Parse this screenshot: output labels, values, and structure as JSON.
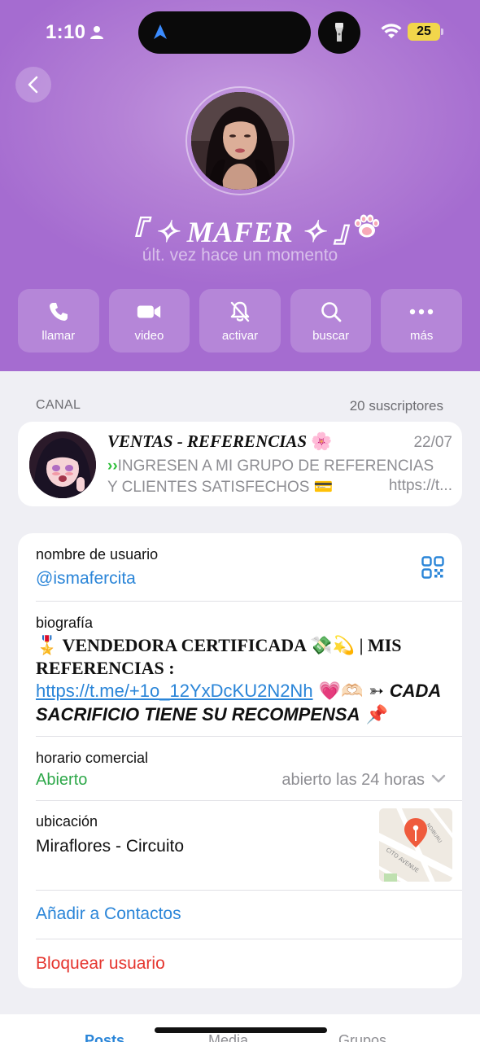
{
  "status_bar": {
    "time": "1:10",
    "battery": "25"
  },
  "profile": {
    "name": "『 ✧ MAFER ✧ 』",
    "last_seen": "últ. vez hace un momento"
  },
  "actions": [
    {
      "label": "llamar",
      "icon": "phone-icon"
    },
    {
      "label": "video",
      "icon": "video-camera-icon"
    },
    {
      "label": "activar",
      "icon": "bell-slash-icon"
    },
    {
      "label": "buscar",
      "icon": "search-icon"
    },
    {
      "label": "más",
      "icon": "more-dots-icon"
    }
  ],
  "channel_section": {
    "label": "CANAL",
    "subscribers": "20 suscriptores",
    "title": "VENTAS - REFERENCIAS",
    "title_emoji": "🌸",
    "date": "22/07",
    "preview_arrows": "››",
    "preview_line1": "INGRESEN A MI GRUPO DE REFERENCIAS",
    "preview_line2": "Y CLIENTES SATISFECHOS 💳",
    "preview_link": "https://t..."
  },
  "info": {
    "username_label": "nombre de usuario",
    "username_value": "@ismafercita",
    "bio_label": "biografía",
    "bio_part1": "🎖️ VENDEDORA CERTIFICADA 💸💫 | MIS REFERENCIAS : ",
    "bio_link": "https://t.me/+1o_12YxDcKU2N2Nh",
    "bio_emojis": " 💗🫶🏻 ➳ ",
    "bio_italic": "CADA SACRIFICIO TIENE SU RECOMPENSA",
    "bio_pin": " 📌",
    "hours_label": "horario comercial",
    "hours_status": "Abierto",
    "hours_detail": "abierto las 24 horas",
    "location_label": "ubicación",
    "location_value": "Miraflores - Circuito",
    "add_contact": "Añadir a Contactos",
    "block_user": "Bloquear usuario"
  },
  "tabs": [
    "Posts",
    "Media",
    "Grupos"
  ],
  "colors": {
    "link_blue": "#2a85d8",
    "open_green": "#2ea84a",
    "danger_red": "#e5352e",
    "header_purple": "#a56cd0"
  }
}
